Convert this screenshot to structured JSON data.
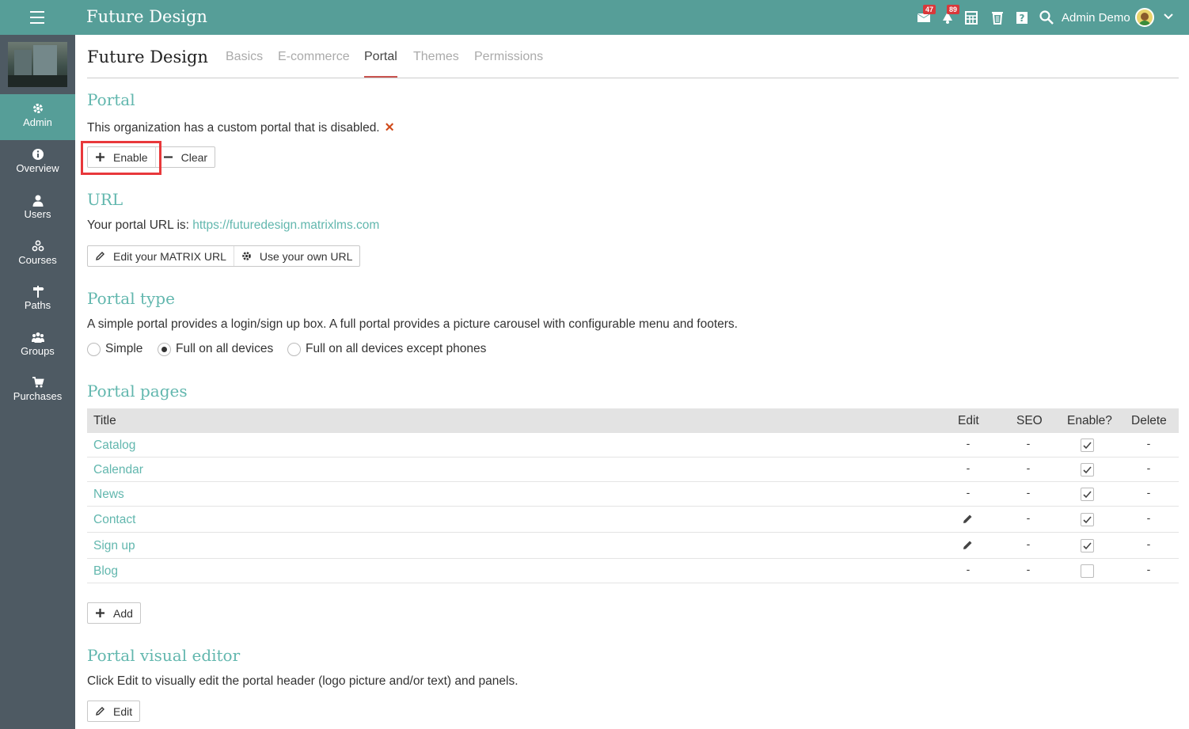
{
  "app": {
    "title": "Future Design"
  },
  "topbar": {
    "messages_badge": "47",
    "notifications_badge": "89",
    "user_name": "Admin Demo"
  },
  "sidebar": {
    "items": [
      {
        "label": "Admin",
        "icon": "gear-icon"
      },
      {
        "label": "Overview",
        "icon": "info-icon"
      },
      {
        "label": "Users",
        "icon": "user-icon"
      },
      {
        "label": "Courses",
        "icon": "courses-icon"
      },
      {
        "label": "Paths",
        "icon": "signpost-icon"
      },
      {
        "label": "Groups",
        "icon": "group-icon"
      },
      {
        "label": "Purchases",
        "icon": "cart-icon"
      }
    ]
  },
  "page": {
    "org_name": "Future Design",
    "tabs": [
      "Basics",
      "E-commerce",
      "Portal",
      "Themes",
      "Permissions"
    ],
    "active_tab": "Portal"
  },
  "portal": {
    "title": "Portal",
    "status_text": "This organization has a custom portal that is disabled.",
    "status_mark": "✕",
    "enable_label": "Enable",
    "clear_label": "Clear"
  },
  "url": {
    "title": "URL",
    "prefix": "Your portal URL is: ",
    "link": "https://futuredesign.matrixlms.com",
    "edit_label": "Edit your MATRIX URL",
    "own_label": "Use your own URL"
  },
  "portal_type": {
    "title": "Portal type",
    "description": "A simple portal provides a login/sign up box. A full portal provides a picture carousel with configurable menu and footers.",
    "options": [
      "Simple",
      "Full on all devices",
      "Full on all devices except phones"
    ],
    "selected": "Full on all devices"
  },
  "portal_pages": {
    "title": "Portal pages",
    "columns": [
      "Title",
      "Edit",
      "SEO",
      "Enable?",
      "Delete"
    ],
    "rows": [
      {
        "title": "Catalog",
        "edit": "-",
        "seo": "-",
        "enabled": true,
        "delete": "-"
      },
      {
        "title": "Calendar",
        "edit": "-",
        "seo": "-",
        "enabled": true,
        "delete": "-"
      },
      {
        "title": "News",
        "edit": "-",
        "seo": "-",
        "enabled": true,
        "delete": "-"
      },
      {
        "title": "Contact",
        "edit": "pencil-icon",
        "seo": "-",
        "enabled": true,
        "delete": "-"
      },
      {
        "title": "Sign up",
        "edit": "pencil-icon",
        "seo": "-",
        "enabled": true,
        "delete": "-"
      },
      {
        "title": "Blog",
        "edit": "-",
        "seo": "-",
        "enabled": false,
        "delete": "-"
      }
    ],
    "add_label": "Add"
  },
  "visual_editor": {
    "title": "Portal visual editor",
    "description": "Click Edit to visually edit the portal header (logo picture and/or text) and panels.",
    "edit_label": "Edit"
  },
  "colors": {
    "topbar": "#569e98",
    "sidebar": "#4e5a63",
    "accent": "#62b7ae",
    "active_tab_underline": "#c9534f",
    "highlight": "#e8383b"
  }
}
